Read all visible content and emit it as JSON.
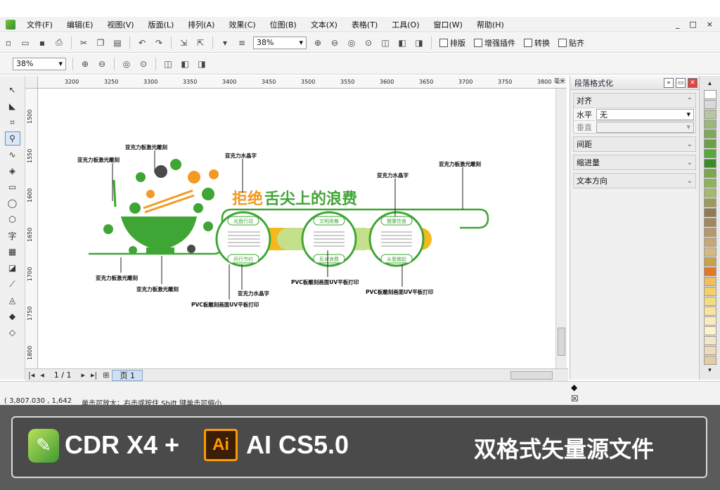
{
  "menubar": {
    "items": [
      "文件(F)",
      "编辑(E)",
      "视图(V)",
      "版面(L)",
      "排列(A)",
      "效果(C)",
      "位图(B)",
      "文本(X)",
      "表格(T)",
      "工具(O)",
      "窗口(W)",
      "帮助(H)"
    ],
    "window_controls": [
      "_",
      "□",
      "×"
    ]
  },
  "toolbar1": {
    "zoom_value": "38%",
    "text_buttons": [
      "排版",
      "增强插件",
      "转换",
      "贴齐"
    ]
  },
  "toolbar2": {
    "zoom_value": "38%"
  },
  "ruler": {
    "h_ticks": [
      "3200",
      "3250",
      "3300",
      "3350",
      "3400",
      "3450",
      "3500",
      "3550",
      "3600",
      "3650",
      "3700",
      "3750",
      "3800"
    ],
    "unit": "毫米",
    "v_ticks": [
      "1500",
      "1550",
      "1600",
      "1650",
      "1700",
      "1750",
      "1800"
    ]
  },
  "docker": {
    "title": "段落格式化",
    "sections": {
      "align": "对齐",
      "horizontal_label": "水平",
      "horizontal_value": "无",
      "vertical_label": "垂直",
      "spacing": "间距",
      "indent": "缩进量",
      "text_direction": "文本方向"
    }
  },
  "pagebar": {
    "count": "1 / 1",
    "tab": "页 1"
  },
  "status": {
    "coords": "( 3,807.030 , 1,642",
    "hint": "单击可放大；右击或按住 Shift 键单击可缩小"
  },
  "artwork": {
    "headline_orange": "拒绝",
    "headline_green": "舌尖上的浪费",
    "labels": {
      "acrylic_laser_1": "亚克力板激光雕刻",
      "acrylic_laser_2": "亚克力板激光雕刻",
      "acrylic_crystal_1": "亚克力水晶字",
      "acrylic_crystal_2": "亚克力水晶字",
      "acrylic_laser_3": "亚克力板激光雕刻",
      "acrylic_laser_4": "亚克力板激光雕刻",
      "acrylic_laser_5": "亚克力板激光雕刻",
      "acrylic_crystal_3": "亚克力水晶字",
      "pvc_1": "PVC板雕刻画面UV平板打印",
      "pvc_2": "PVC板雕刻画面UV平板打印",
      "pvc_3": "PVC板雕刻画面UV平板打印"
    },
    "circle_tags": {
      "c1_top": "光盘行动",
      "c1_bottom": "厉行节约",
      "c2_top": "文明用餐",
      "c2_bottom": "反对浪费",
      "c3_top": "健康饮食",
      "c3_bottom": "从我做起"
    }
  },
  "palette": {
    "colors": [
      "#ffffff",
      "#d9d9d9",
      "#b4c7a0",
      "#9bb87a",
      "#7ea85a",
      "#6e9e47",
      "#55a83a",
      "#3d8a2c",
      "#7aa84a",
      "#8fb25c",
      "#a6b86b",
      "#9e9a5c",
      "#8f7c4c",
      "#a5865a",
      "#b89966",
      "#c6a872",
      "#d4b880",
      "#caa24a",
      "#e07a2a",
      "#f0c060",
      "#f4d06a",
      "#f6dc80",
      "#f8e4a0",
      "#fbecc0",
      "#fdf2d0",
      "#f6e6c8",
      "#eedcb8",
      "#e4cca2"
    ]
  },
  "banner": {
    "cdr_logo": "✎",
    "cdr_text": "CDR X4 +",
    "ai_logo": "Ai",
    "ai_text": "AI CS5.0",
    "right_text": "双格式矢量源文件"
  }
}
